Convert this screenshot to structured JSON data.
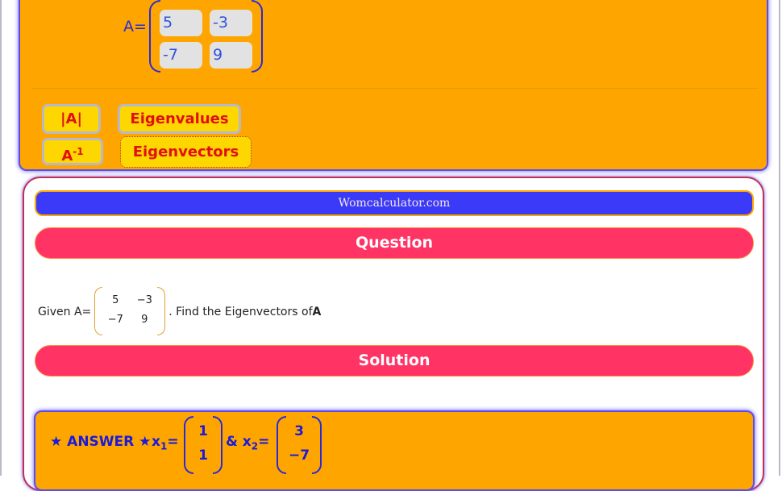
{
  "input": {
    "matrix_label": "A=",
    "cells": {
      "a11": "5",
      "a12": "-3",
      "a21": "-7",
      "a22": "9"
    }
  },
  "buttons": {
    "determinant": "|A|",
    "eigenvalues": "Eigenvalues",
    "inverse_base": "A",
    "inverse_exp": "-1",
    "eigenvectors": "Eigenvectors"
  },
  "result": {
    "site_name": "Womcalculator.com",
    "question_heading": "Question",
    "question": {
      "prefix": "Given A=",
      "matrix": {
        "a11": "5",
        "a12": "−3",
        "a21": "−7",
        "a22": "9"
      },
      "suffix": ". Find the Eigenvectors of ",
      "target": "A"
    },
    "solution_heading": "Solution",
    "answer": {
      "label": "★ ANSWER ★",
      "x1_name": "x",
      "x1_sub": "1",
      "x1_values": [
        "1",
        "1"
      ],
      "joiner": "&",
      "x2_name": "x",
      "x2_sub": "2",
      "x2_values": [
        "3",
        "−7"
      ],
      "equals": "="
    }
  },
  "colors": {
    "panel_orange": "#ffa500",
    "button_yellow": "#ffd700",
    "button_text_red": "#e01010",
    "site_bar_blue": "#3a3af8",
    "section_bar_pink": "#ff3364",
    "matrix_blue": "#2a2ad8"
  }
}
